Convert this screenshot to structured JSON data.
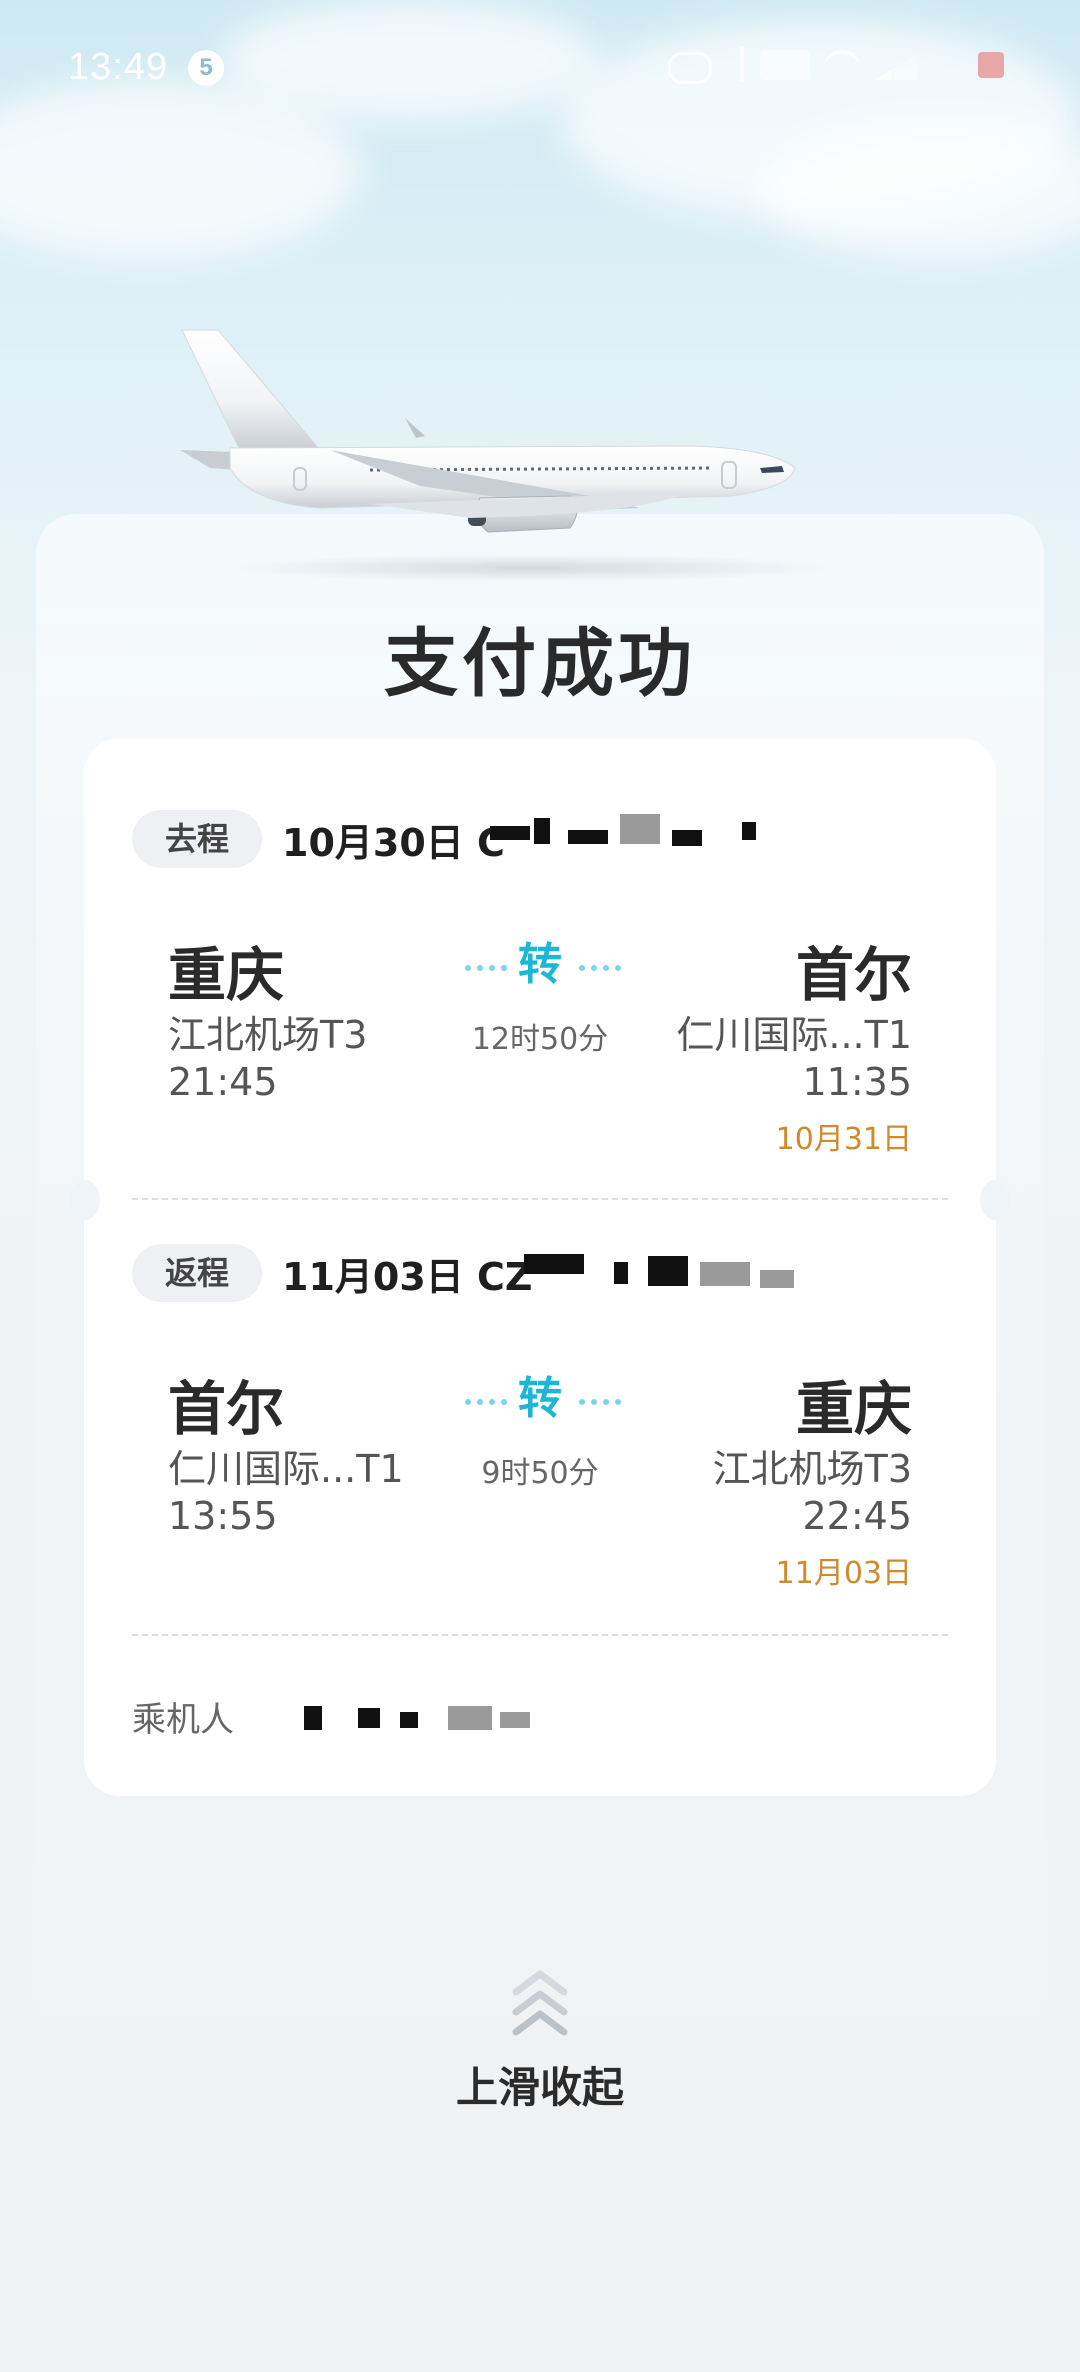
{
  "status_bar": {
    "time": "13:49",
    "notification_count": "5"
  },
  "title": "支付成功",
  "outbound": {
    "tag": "去程",
    "date": "10月30日",
    "flight_prefix": "C",
    "from_city": "重庆",
    "from_airport": "江北机场T3",
    "depart_time": "21:45",
    "transfer_label": "转",
    "duration": "12时50分",
    "to_city": "首尔",
    "to_airport": "仁川国际...T1",
    "arrive_time": "11:35",
    "arrive_date": "10月31日"
  },
  "return": {
    "tag": "返程",
    "date": "11月03日",
    "flight_prefix": "CZ",
    "from_city": "首尔",
    "from_airport": "仁川国际...T1",
    "depart_time": "13:55",
    "transfer_label": "转",
    "duration": "9时50分",
    "to_city": "重庆",
    "to_airport": "江北机场T3",
    "arrive_time": "22:45",
    "arrive_date": "11月03日"
  },
  "passenger": {
    "label": "乘机人"
  },
  "footer": {
    "icon": "double-chevron-up-icon",
    "label": "上滑收起"
  },
  "colors": {
    "accent_transfer": "#1fb6d6",
    "arrival_date": "#d08a2c",
    "title": "#2a2a2a"
  }
}
